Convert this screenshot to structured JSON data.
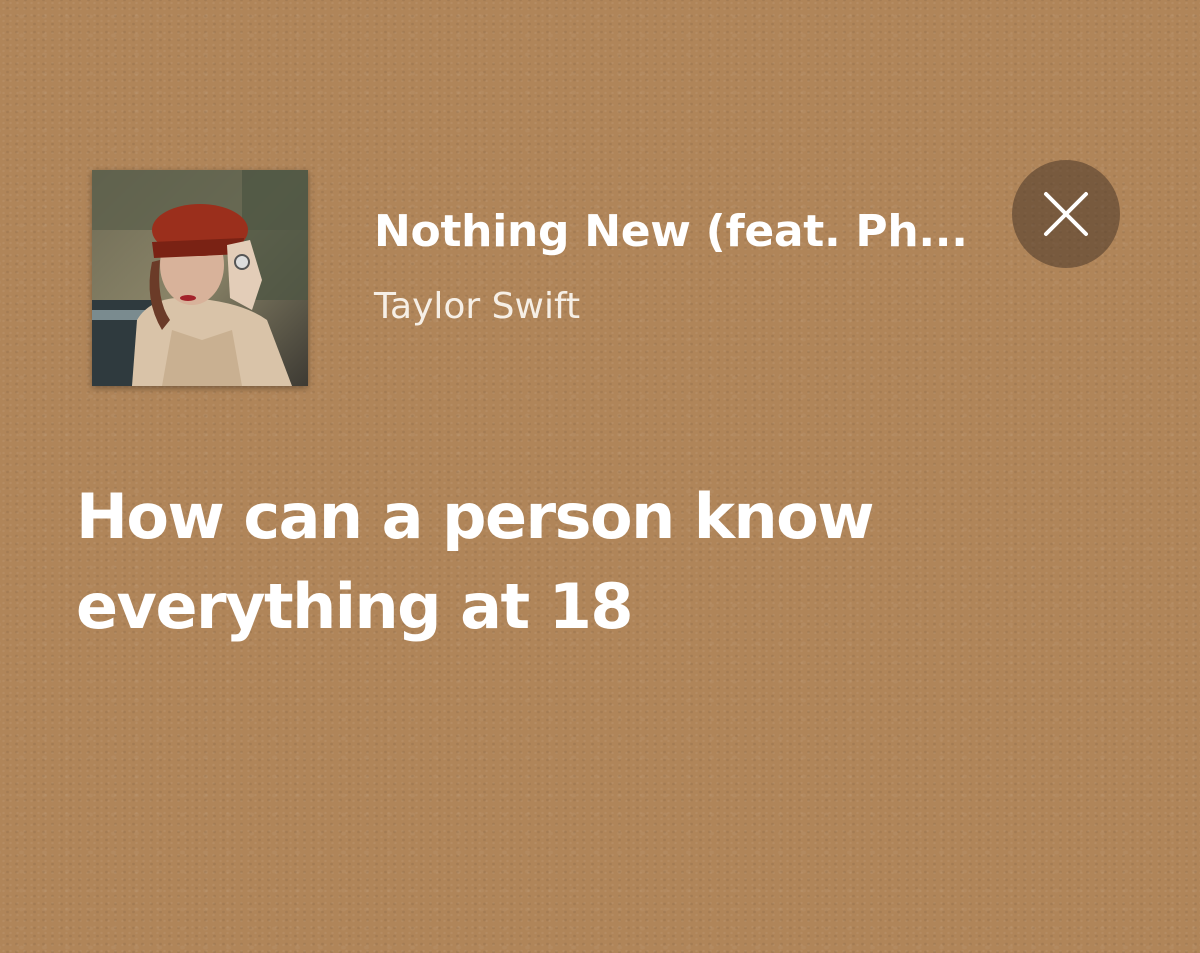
{
  "track": {
    "title": "Nothing New (feat. Ph...",
    "artist": "Taylor Swift"
  },
  "lyric": {
    "line1": "How can a person know",
    "line2": "everything at 18"
  },
  "controls": {
    "close_icon": "close-icon"
  },
  "colors": {
    "background": "#b08559",
    "text": "#ffffff",
    "close_button_bg": "#4b3728"
  }
}
